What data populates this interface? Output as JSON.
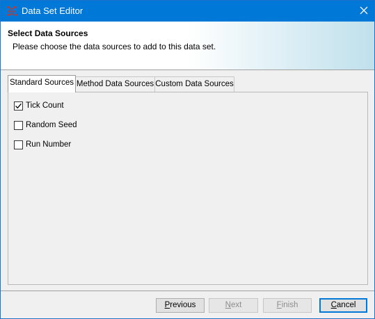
{
  "window": {
    "title": "Data Set Editor",
    "icons": {
      "app": "grid-dots-icon",
      "close": "close-icon"
    }
  },
  "header": {
    "title": "Select Data Sources",
    "description": "Please choose the data sources to add to this data set."
  },
  "tabs": [
    {
      "label": "Standard Sources",
      "active": true
    },
    {
      "label": "Method Data Sources",
      "active": false
    },
    {
      "label": "Custom Data Sources",
      "active": false
    }
  ],
  "sources": [
    {
      "label": "Tick Count",
      "checked": true
    },
    {
      "label": "Random Seed",
      "checked": false
    },
    {
      "label": "Run Number",
      "checked": false
    }
  ],
  "buttons": {
    "previous": {
      "label_mnemonic": "P",
      "label_rest": "revious",
      "enabled": true
    },
    "next": {
      "label_mnemonic": "N",
      "label_rest": "ext",
      "enabled": false
    },
    "finish": {
      "label_mnemonic": "F",
      "label_rest": "inish",
      "enabled": false
    },
    "cancel": {
      "label_mnemonic": "C",
      "label_rest": "ancel",
      "enabled": true
    }
  },
  "colors": {
    "titlebar": "#0078d7",
    "accent": "#0078d7",
    "app_icon": "#c0392b"
  }
}
